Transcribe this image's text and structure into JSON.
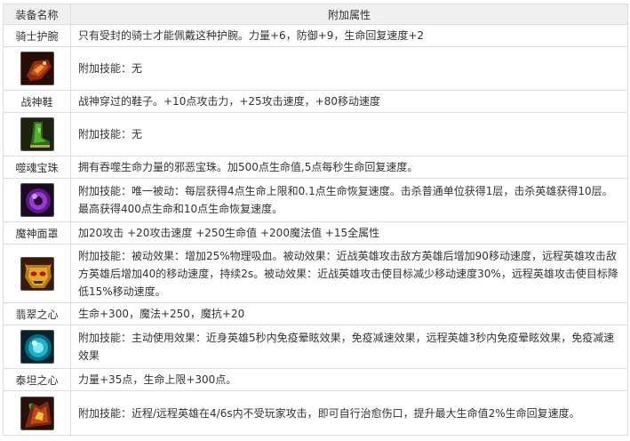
{
  "table": {
    "header_name": "装备名称",
    "header_attr": "附加属性"
  },
  "items": [
    {
      "name": "骑士护腕",
      "desc": "只有受封的骑士才能佩戴这种护腕。力量+6，防御+9，生命回复速度+2",
      "icon": "knight-bracer-icon",
      "skill": "附加技能：无"
    },
    {
      "name": "战神鞋",
      "desc": "战神穿过的鞋子。+10点攻击力，+25攻击速度，+80移动速度",
      "icon": "war-god-boots-icon",
      "skill": "附加技能：无"
    },
    {
      "name": "噬魂宝珠",
      "desc": "拥有吞噬生命力量的邪恶宝珠。加500点生命值,5点每秒生命回复速度。",
      "icon": "soul-orb-icon",
      "skill": "附加技能：唯一被动：每层获得4点生命上限和0.1点生命恢复速度。击杀普通单位获得1层，击杀英雄获得10层。最高获得400点生命和10点生命恢复速度。"
    },
    {
      "name": "魔神面罩",
      "desc": "加20攻击 +20攻击速度 +250生命值 +200魔法值 +15全属性",
      "icon": "demon-mask-icon",
      "skill": "附加技能：被动效果：增加25%物理吸血。被动效果：近战英雄攻击敌方英雄后增加90移动速度，远程英雄攻击敌方英雄后增加40的移动速度，持续2s。被动效果：近战英雄攻击使目标减少移动速度30%，远程英雄攻击使目标降低15%移动速度。"
    },
    {
      "name": "翡翠之心",
      "desc": "生命+300，魔法+250，魔抗+20",
      "icon": "emerald-heart-icon",
      "skill": "附加技能：主动使用效果：近身英雄5秒内免疫晕眩效果，免疫减速效果，远程英雄3秒内免疫晕眩效果，免疫减速效果"
    },
    {
      "name": "泰坦之心",
      "desc": "力量+35点，生命上限+300点。",
      "icon": "titan-heart-icon",
      "skill": "附加技能：近程/远程英雄在4/6s内不受玩家攻击，即可自行治愈伤口，提升最大生命值2%生命回复速度。"
    }
  ]
}
